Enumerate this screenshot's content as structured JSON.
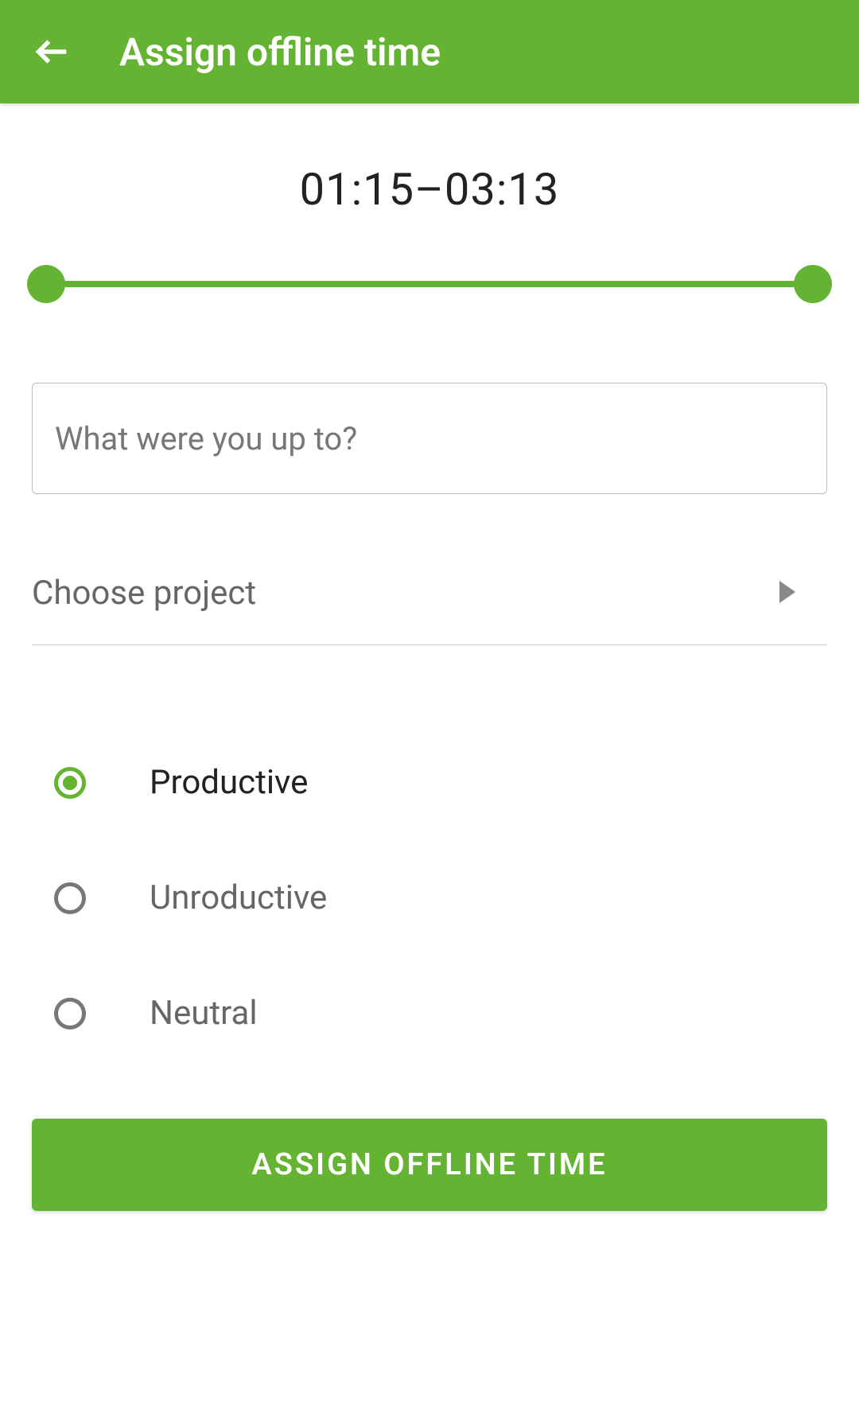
{
  "header": {
    "title": "Assign offline time"
  },
  "timeRange": "01:15–03:13",
  "description": {
    "placeholder": "What were you up to?",
    "value": ""
  },
  "project": {
    "label": "Choose project"
  },
  "radioOptions": [
    {
      "label": "Productive",
      "selected": true
    },
    {
      "label": "Unroductive",
      "selected": false
    },
    {
      "label": "Neutral",
      "selected": false
    }
  ],
  "submitButton": {
    "label": "ASSIGN OFFLINE TIME"
  },
  "colors": {
    "accent": "#64b333"
  }
}
